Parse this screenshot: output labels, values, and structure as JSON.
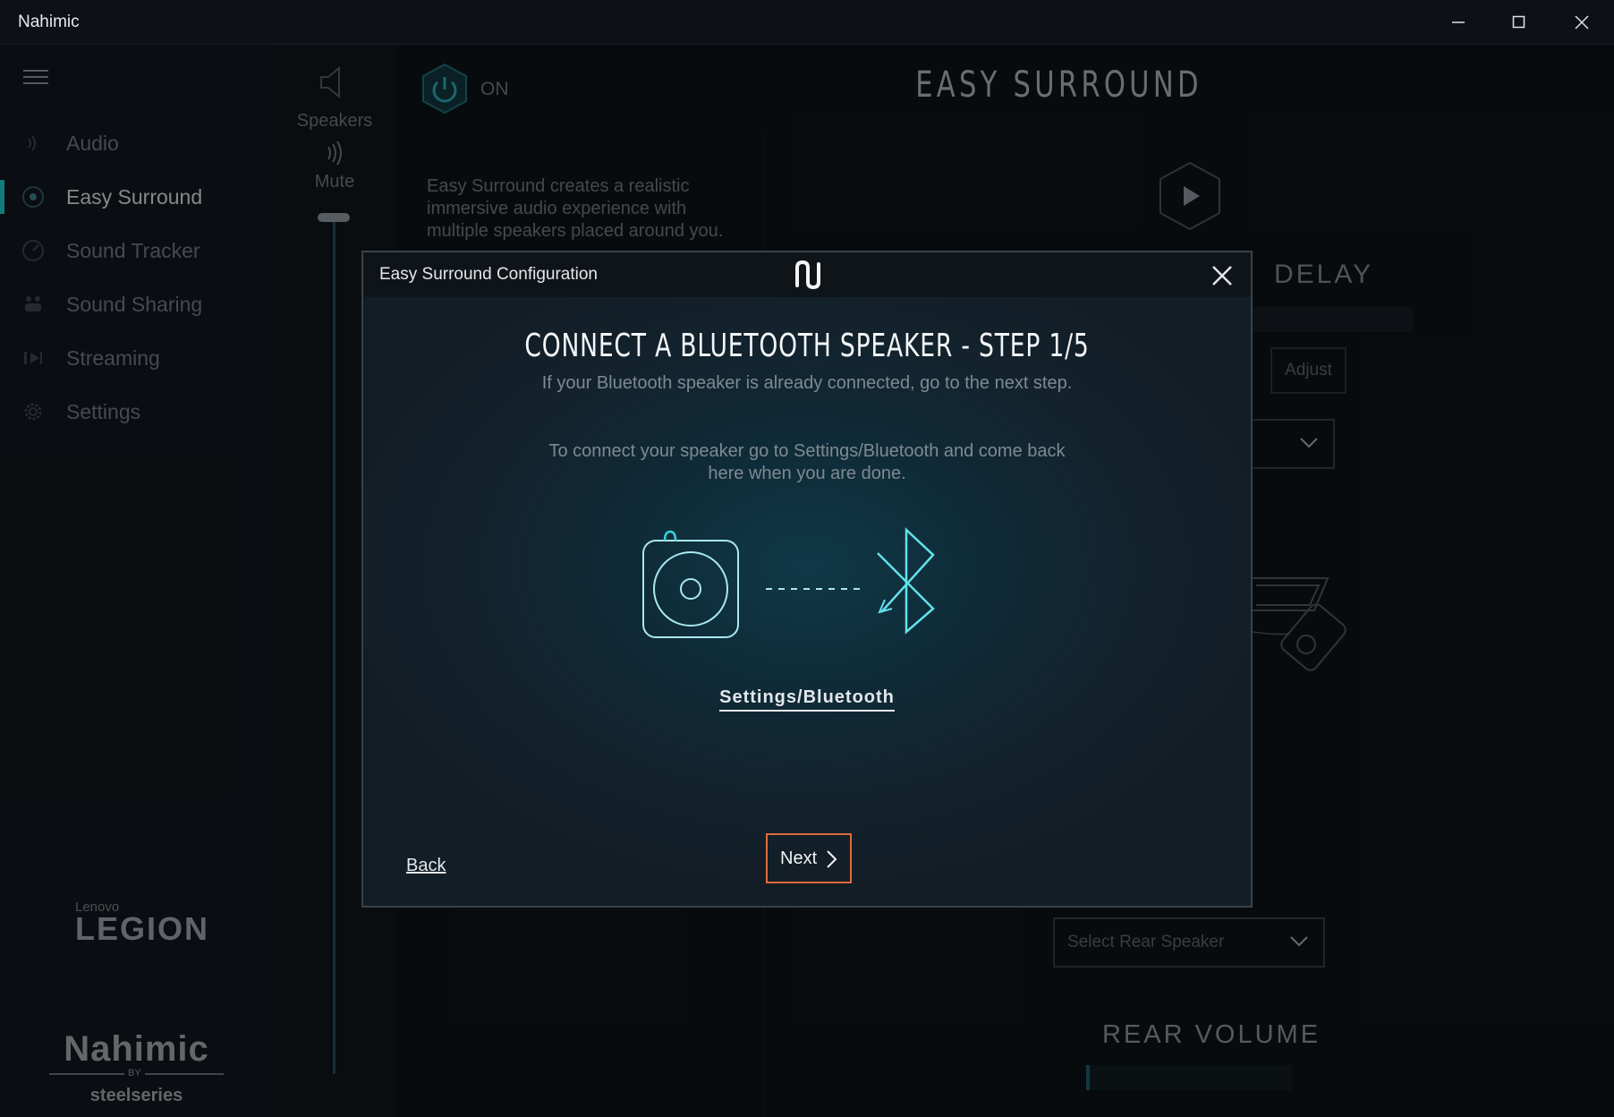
{
  "window": {
    "title": "Nahimic",
    "controls": [
      "minimize-icon",
      "maximize-icon",
      "close-icon"
    ]
  },
  "sidebar": {
    "items": [
      {
        "label": "Audio",
        "icon": "audio-waves-icon",
        "active": false
      },
      {
        "label": "Easy Surround",
        "icon": "surround-icon",
        "active": true
      },
      {
        "label": "Sound Tracker",
        "icon": "radar-icon",
        "active": false
      },
      {
        "label": "Sound Sharing",
        "icon": "sharing-icon",
        "active": false
      },
      {
        "label": "Streaming",
        "icon": "streaming-icon",
        "active": false
      },
      {
        "label": "Settings",
        "icon": "gear-icon",
        "active": false
      }
    ],
    "brand_lenovo_small": "Lenovo",
    "brand_lenovo_big": "LEGION",
    "brand_nahimic": "Nahimic",
    "brand_by": "BY",
    "brand_steelseries": "steelseries"
  },
  "volume": {
    "device_label": "Speakers",
    "mute_label": "Mute",
    "level": 1.0
  },
  "main": {
    "power_label": "ON",
    "title": "EASY SURROUND",
    "description": "Easy Surround creates a realistic immersive audio experience with multiple speakers placed around you.",
    "delay_title": "DELAY",
    "adjust_label": "Adjust",
    "rear_speaker_placeholder": "Select Rear Speaker",
    "rear_volume_title": "REAR VOLUME"
  },
  "modal": {
    "title": "Easy Surround Configuration",
    "step_title": "CONNECT A BLUETOOTH SPEAKER - STEP 1/5",
    "paragraph1": "If your Bluetooth speaker is already connected, go to the next step.",
    "paragraph2": "To connect your speaker go to Settings/Bluetooth and come back here when you are done.",
    "link_label": "Settings/Bluetooth",
    "back_label": "Back",
    "next_label": "Next",
    "accent_color": "#1ec7c7",
    "next_border_color": "#e06a3c"
  }
}
